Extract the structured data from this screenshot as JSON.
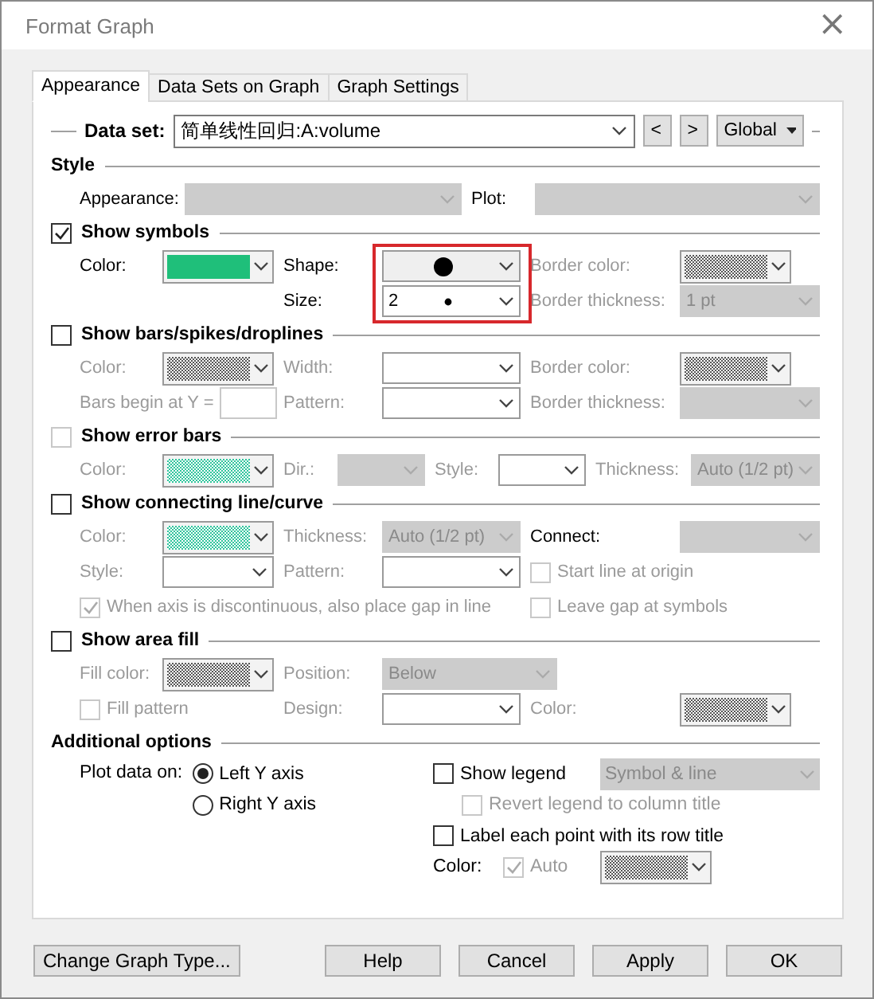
{
  "window": {
    "title": "Format Graph",
    "close": "×"
  },
  "tabs": [
    {
      "label": "Appearance",
      "selected": true
    },
    {
      "label": "Data Sets on Graph",
      "selected": false
    },
    {
      "label": "Graph Settings",
      "selected": false
    }
  ],
  "dataset": {
    "label": "Data set:",
    "value": "简单线性回归:A:volume",
    "prev": "<",
    "next": ">",
    "scope": "Global"
  },
  "sections": [
    {
      "title": "Style",
      "rows": [
        {
          "kind": "pair",
          "items": [
            {
              "kind": "label",
              "text": "Appearance:",
              "disabled": false
            },
            {
              "kind": "combo",
              "disabled": true
            },
            {
              "kind": "label",
              "text": "Plot:",
              "disabled": false
            },
            {
              "kind": "combo",
              "disabled": true
            }
          ]
        }
      ]
    },
    {
      "title": "Show symbols",
      "checked": true,
      "disabled": false,
      "rows": [
        {
          "kind": "triple",
          "items": [
            {
              "kind": "label",
              "text": "Color:",
              "disabled": false
            },
            {
              "kind": "swatch",
              "color": "#1fbf7a",
              "hatched": false
            },
            {
              "kind": "label",
              "text": "Shape:",
              "disabled": false
            },
            {
              "kind": "shape",
              "disabled": false,
              "highlighted": true
            },
            {
              "kind": "label",
              "text": "Border color:",
              "disabled": true
            },
            {
              "kind": "swatch",
              "color": "#555555",
              "hatched": true
            }
          ]
        },
        {
          "kind": "triple",
          "items": [
            {
              "kind": "blank"
            },
            {
              "kind": "blank"
            },
            {
              "kind": "label",
              "text": "Size:",
              "disabled": false
            },
            {
              "kind": "size",
              "disabled": false,
              "value": "2",
              "highlighted": true
            },
            {
              "kind": "label",
              "text": "Border thickness:",
              "disabled": true
            },
            {
              "kind": "combo",
              "disabled": true,
              "value": "1 pt"
            }
          ]
        }
      ]
    },
    {
      "title": "Show bars/spikes/droplines",
      "checked": false,
      "disabled": false,
      "rows": [
        {
          "kind": "triple",
          "items": [
            {
              "kind": "label",
              "text": "Color:",
              "disabled": true
            },
            {
              "kind": "swatch",
              "color": "#555555",
              "hatched": true
            },
            {
              "kind": "label",
              "text": "Width:",
              "disabled": true
            },
            {
              "kind": "combo",
              "disabled": false
            },
            {
              "kind": "label",
              "text": "Border color:",
              "disabled": true
            },
            {
              "kind": "swatch",
              "color": "#555555",
              "hatched": true
            }
          ]
        },
        {
          "kind": "triple",
          "items": [
            {
              "kind": "labelinput",
              "text": "Bars begin at Y =",
              "disabled": true
            },
            {
              "kind": "label",
              "text": "Pattern:",
              "disabled": true
            },
            {
              "kind": "combo",
              "disabled": false
            },
            {
              "kind": "label",
              "text": "Border thickness:",
              "disabled": true
            },
            {
              "kind": "combo",
              "disabled": true
            }
          ]
        }
      ]
    },
    {
      "title": "Show error bars",
      "checked": false,
      "disabled": true,
      "rows": [
        {
          "kind": "quad",
          "items": [
            {
              "kind": "label",
              "text": "Color:",
              "disabled": true
            },
            {
              "kind": "swatch",
              "color": "#2fc49c",
              "hatched": true
            },
            {
              "kind": "label",
              "text": "Dir.:",
              "disabled": true
            },
            {
              "kind": "combo",
              "disabled": true
            },
            {
              "kind": "label",
              "text": "Style:",
              "disabled": true
            },
            {
              "kind": "combo",
              "disabled": false
            },
            {
              "kind": "label",
              "text": "Thickness:",
              "disabled": true
            },
            {
              "kind": "combo",
              "disabled": true,
              "value": "Auto (1/2 pt)"
            }
          ]
        }
      ]
    },
    {
      "title": "Show connecting line/curve",
      "checked": false,
      "disabled": false,
      "rows": [
        {
          "kind": "triple",
          "items": [
            {
              "kind": "label",
              "text": "Color:",
              "disabled": true
            },
            {
              "kind": "swatch",
              "color": "#2fc49c",
              "hatched": true
            },
            {
              "kind": "label",
              "text": "Thickness:",
              "disabled": true
            },
            {
              "kind": "combo",
              "disabled": true,
              "value": "Auto (1/2 pt)"
            },
            {
              "kind": "label",
              "text": "Connect:",
              "disabled": false
            },
            {
              "kind": "combo",
              "disabled": true
            }
          ]
        },
        {
          "kind": "triple",
          "items": [
            {
              "kind": "label",
              "text": "Style:",
              "disabled": true
            },
            {
              "kind": "combo",
              "disabled": false
            },
            {
              "kind": "label",
              "text": "Pattern:",
              "disabled": true
            },
            {
              "kind": "combo",
              "disabled": false
            },
            {
              "kind": "check",
              "text": "Start line at origin",
              "checked": false,
              "disabled": true
            }
          ]
        },
        {
          "kind": "triple",
          "items": [
            {
              "kind": "check",
              "text": "When axis is discontinuous, also place gap in line",
              "checked": true,
              "disabled": true
            },
            {
              "kind": "check",
              "text": "Leave gap at symbols",
              "checked": false,
              "disabled": true
            }
          ]
        }
      ]
    },
    {
      "title": "Show area fill",
      "checked": false,
      "disabled": false,
      "rows": [
        {
          "kind": "triple",
          "items": [
            {
              "kind": "label",
              "text": "Fill color:",
              "disabled": true
            },
            {
              "kind": "swatch",
              "color": "#555555",
              "hatched": true
            },
            {
              "kind": "label",
              "text": "Position:",
              "disabled": true
            },
            {
              "kind": "combo",
              "disabled": true,
              "value": "Below",
              "wide": true
            }
          ]
        },
        {
          "kind": "triple",
          "items": [
            {
              "kind": "check",
              "text": "Fill pattern",
              "checked": false,
              "disabled": true
            },
            {
              "kind": "label",
              "text": "Design:",
              "disabled": true
            },
            {
              "kind": "combo",
              "disabled": false
            },
            {
              "kind": "label",
              "text": "Color:",
              "disabled": true
            },
            {
              "kind": "swatch",
              "color": "#555555",
              "hatched": true
            }
          ]
        }
      ]
    }
  ],
  "additional": {
    "title": "Additional options",
    "plot_label": "Plot data on:",
    "axes": [
      {
        "label": "Left Y axis",
        "selected": true
      },
      {
        "label": "Right  Y axis",
        "selected": false
      }
    ],
    "legend": {
      "text": "Show legend",
      "checked": false,
      "disabled": false,
      "style": "Symbol & line"
    },
    "revert": {
      "text": "Revert legend to column title",
      "checked": false,
      "disabled": true
    },
    "label_points": {
      "text": "Label each point with its row title",
      "checked": false,
      "disabled": false
    },
    "color_label": "Color:",
    "auto": {
      "text": "Auto",
      "checked": true,
      "disabled": true
    },
    "color": "#555555"
  },
  "buttons": [
    {
      "label": "Change Graph Type...",
      "kind": "left"
    },
    {
      "label": "Help",
      "kind": "right"
    },
    {
      "label": "Cancel",
      "kind": "right"
    },
    {
      "label": "Apply",
      "kind": "right"
    },
    {
      "label": "OK",
      "kind": "right"
    }
  ]
}
